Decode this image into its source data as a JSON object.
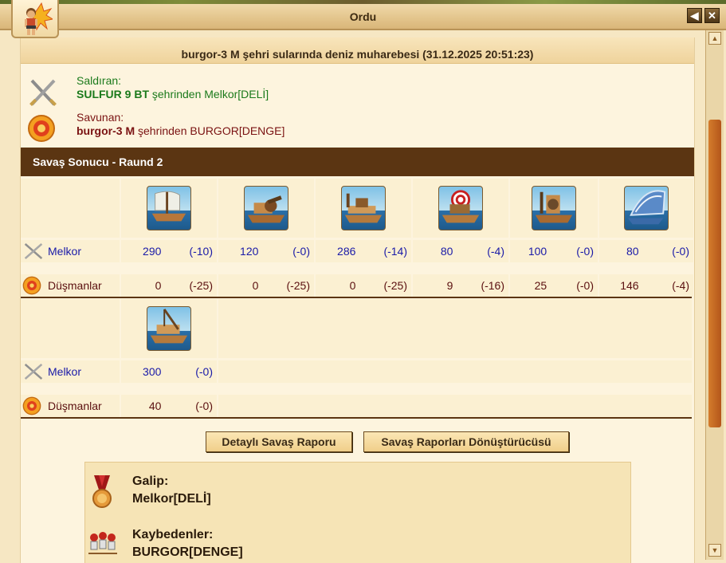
{
  "window": {
    "title": "Ordu"
  },
  "report": {
    "header": "burgor-3 M şehri sularında deniz muharebesi (31.12.2025 20:51:23)",
    "attacker": {
      "role": "Saldıran:",
      "city": "SULFUR 9 BT",
      "suffix": " şehrinden Melkor[DELİ]"
    },
    "defender": {
      "role": "Savunan:",
      "city": "burgor-3 M",
      "suffix": " şehrinden BURGOR[DENGE]"
    },
    "round_bar": "Savaş Sonucu - Raund 2",
    "rows": {
      "own_label": "Melkor",
      "enemy_label": "Düşmanlar"
    },
    "units_row1": [
      {
        "icon": "ram-ship-icon",
        "own": "290",
        "own_loss": "(-10)",
        "enemy": "0",
        "enemy_loss": "(-25)"
      },
      {
        "icon": "ballista-ship-icon",
        "own": "120",
        "own_loss": "(-0)",
        "enemy": "0",
        "enemy_loss": "(-25)"
      },
      {
        "icon": "flamethrower-ship-icon",
        "own": "286",
        "own_loss": "(-14)",
        "enemy": "0",
        "enemy_loss": "(-25)"
      },
      {
        "icon": "mortar-ship-icon",
        "own": "80",
        "own_loss": "(-4)",
        "enemy": "9",
        "enemy_loss": "(-16)"
      },
      {
        "icon": "catapult-ship-icon",
        "own": "100",
        "own_loss": "(-0)",
        "enemy": "25",
        "enemy_loss": "(-0)"
      },
      {
        "icon": "paddle-speedboat-icon",
        "own": "80",
        "own_loss": "(-0)",
        "enemy": "146",
        "enemy_loss": "(-4)"
      }
    ],
    "units_row2": [
      {
        "icon": "tender-ship-icon",
        "own": "300",
        "own_loss": "(-0)",
        "enemy": "40",
        "enemy_loss": "(-0)"
      }
    ],
    "buttons": {
      "detailed": "Detaylı Savaş Raporu",
      "converter": "Savaş Raporları Dönüştürücüsü"
    },
    "winner": {
      "label": "Galip:",
      "name": "Melkor[DELİ]"
    },
    "losers": {
      "label": "Kaybedenler:",
      "name": "BURGOR[DENGE]"
    }
  },
  "colors": {
    "bar": "#5b3512",
    "attacker": "#1b7a1b",
    "defender": "#7a1212",
    "own_numbers": "#1a1aa8",
    "scroll_thumb": "#c4661f"
  }
}
